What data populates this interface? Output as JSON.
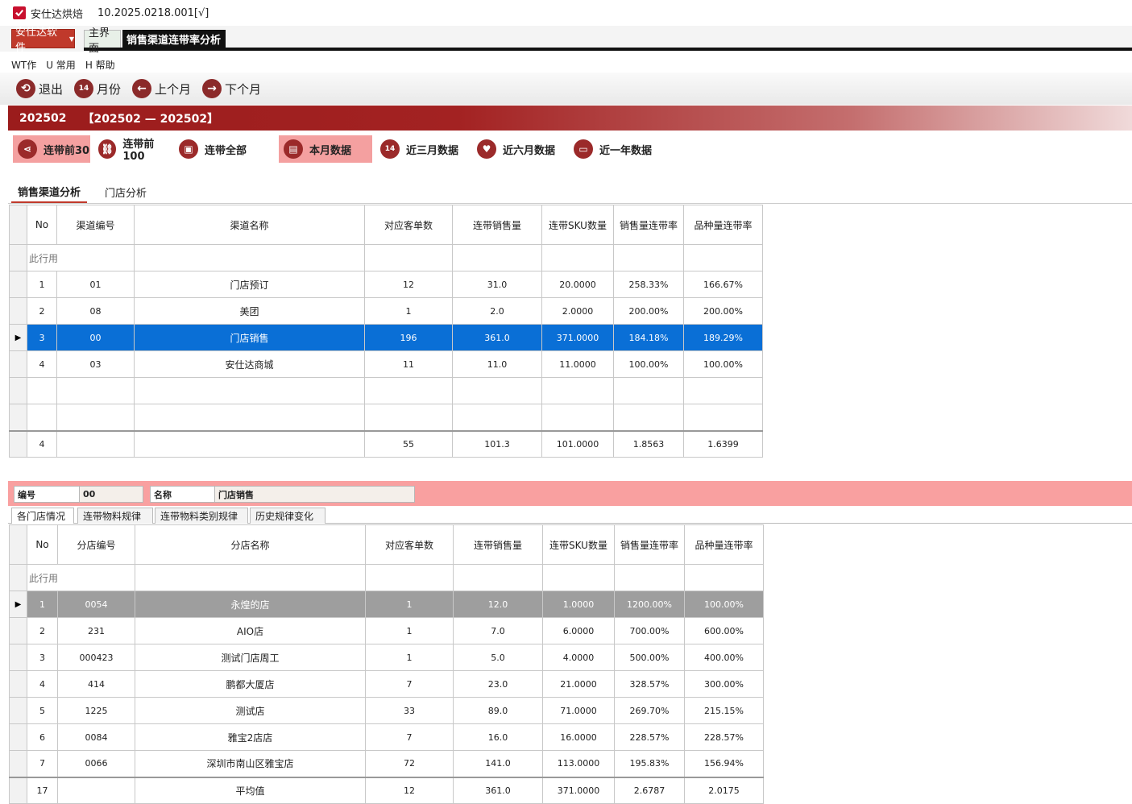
{
  "window": {
    "title": "安仕达烘焙",
    "version": "10.2025.0218.001[√]"
  },
  "modules": {
    "brand": "安仕达软件",
    "home_tab": "主界面",
    "active_tab": "销售渠道连带率分析"
  },
  "menu": [
    "WT作",
    "U 常用",
    "H 帮助"
  ],
  "toolbar": [
    {
      "label": "退出",
      "icon": "exit-icon"
    },
    {
      "label": "月份",
      "icon": "calendar-icon"
    },
    {
      "label": "上个月",
      "icon": "arrow-left-icon"
    },
    {
      "label": "下个月",
      "icon": "arrow-right-icon"
    }
  ],
  "period": {
    "current": "202502",
    "range": "【202502 — 202502】"
  },
  "filters": [
    {
      "label": "连带前30",
      "icon": "share-icon",
      "selected": true
    },
    {
      "label": "连带前100",
      "icon": "link-icon",
      "selected": false
    },
    {
      "label": "连带全部",
      "icon": "chart-icon",
      "selected": false
    },
    {
      "label": "本月数据",
      "icon": "clipboard-icon",
      "selected": true
    },
    {
      "label": "近三月数据",
      "icon": "calendar-icon",
      "selected": false
    },
    {
      "label": "近六月数据",
      "icon": "heart-icon",
      "selected": false
    },
    {
      "label": "近一年数据",
      "icon": "monitor-icon",
      "selected": false
    }
  ],
  "section_tabs": [
    "销售渠道分析",
    "门店分析"
  ],
  "channel_table": {
    "headers": [
      "No",
      "渠道编号",
      "渠道名称",
      "对应客单数",
      "连带销售量",
      "连带SKU数量",
      "销售量连带率",
      "品种量连带率"
    ],
    "pinned_label": "此行用",
    "rows": [
      [
        "1",
        "01",
        "门店预订",
        "12",
        "31.0",
        "20.0000",
        "258.33%",
        "166.67%"
      ],
      [
        "2",
        "08",
        "美团",
        "1",
        "2.0",
        "2.0000",
        "200.00%",
        "200.00%"
      ],
      [
        "3",
        "00",
        "门店销售",
        "196",
        "361.0",
        "371.0000",
        "184.18%",
        "189.29%"
      ],
      [
        "4",
        "03",
        "安仕达商城",
        "11",
        "11.0",
        "11.0000",
        "100.00%",
        "100.00%"
      ]
    ],
    "selected_index": 2,
    "total": [
      "4",
      "",
      "",
      "55",
      "101.3",
      "101.0000",
      "1.8563",
      "1.6399"
    ]
  },
  "detail": {
    "code_label": "编号",
    "code_value": "00",
    "name_label": "名称",
    "name_value": "门店销售"
  },
  "detail_tabs": [
    "各门店情况",
    "连带物料规律",
    "连带物料类别规律",
    "历史规律变化"
  ],
  "store_table": {
    "headers": [
      "No",
      "分店编号",
      "分店名称",
      "对应客单数",
      "连带销售量",
      "连带SKU数量",
      "销售量连带率",
      "品种量连带率"
    ],
    "pinned_label": "此行用",
    "rows": [
      [
        "1",
        "0054",
        "永煌的店",
        "1",
        "12.0",
        "1.0000",
        "1200.00%",
        "100.00%"
      ],
      [
        "2",
        "231",
        "AIO店",
        "1",
        "7.0",
        "6.0000",
        "700.00%",
        "600.00%"
      ],
      [
        "3",
        "000423",
        "测试门店周工",
        "1",
        "5.0",
        "4.0000",
        "500.00%",
        "400.00%"
      ],
      [
        "4",
        "414",
        "鹏都大厦店",
        "7",
        "23.0",
        "21.0000",
        "328.57%",
        "300.00%"
      ],
      [
        "5",
        "1225",
        "测试店",
        "33",
        "89.0",
        "71.0000",
        "269.70%",
        "215.15%"
      ],
      [
        "6",
        "0084",
        "雅宝2店店",
        "7",
        "16.0",
        "16.0000",
        "228.57%",
        "228.57%"
      ],
      [
        "7",
        "0066",
        "深圳市南山区雅宝店",
        "72",
        "141.0",
        "113.0000",
        "195.83%",
        "156.94%"
      ]
    ],
    "selected_index": 0,
    "total": [
      "17",
      "",
      "平均值",
      "12",
      "361.0",
      "371.0000",
      "2.6787",
      "2.0175"
    ]
  }
}
